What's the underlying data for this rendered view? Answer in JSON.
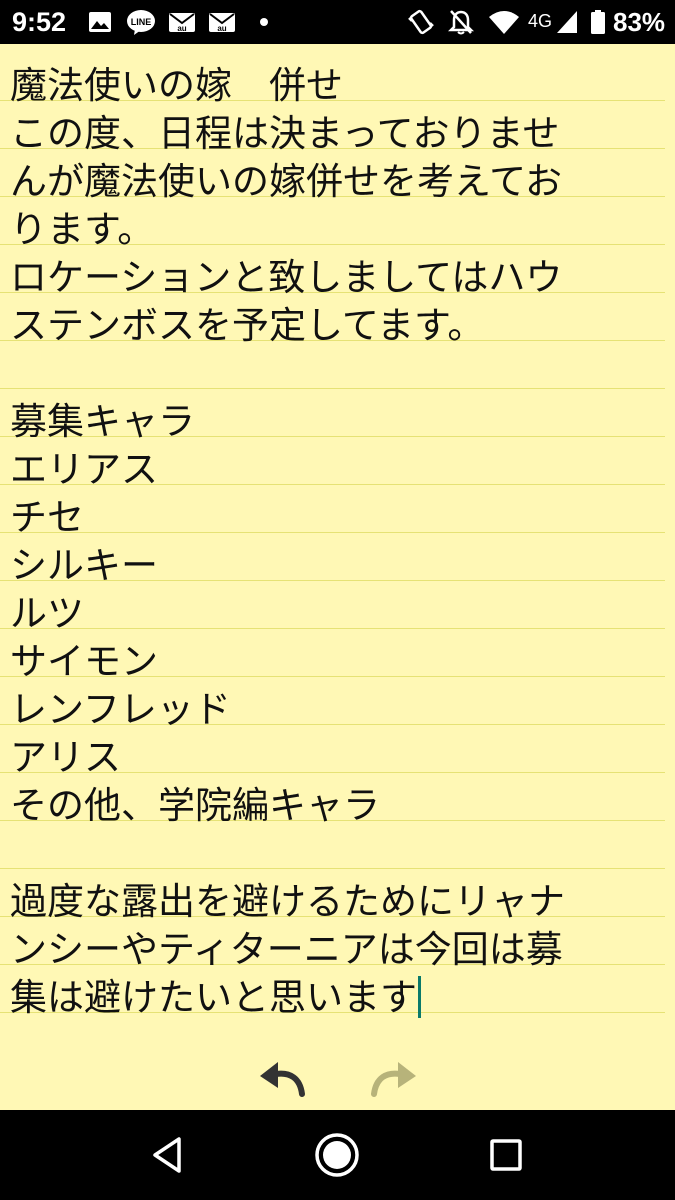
{
  "status_bar": {
    "time": "9:52",
    "network": "4G",
    "battery": "83%",
    "icons": [
      "gallery-icon",
      "line-app-icon",
      "au-mail-icon",
      "au-mail-icon",
      "notification-dot-icon",
      "vibrate-icon",
      "notifications-off-icon",
      "wifi-icon",
      "cellular-signal-icon",
      "battery-icon"
    ],
    "line_badge": "LINE",
    "au_badge": "au"
  },
  "note": {
    "lines": [
      "魔法使いの嫁　併せ",
      "この度、日程は決まっておりませ",
      "んが魔法使いの嫁併せを考えてお",
      "ります。",
      "ロケーションと致しましてはハウ",
      "ステンボスを予定してます。",
      "",
      "募集キャラ",
      "エリアス",
      "チセ",
      "シルキー",
      "ルツ",
      "サイモン",
      "レンフレッド",
      "アリス",
      "その他、学院編キャラ",
      "",
      "過度な露出を避けるためにリャナ",
      "ンシーやティターニアは今回は募",
      "集は避けたいと思います"
    ],
    "cursor_after_line": 19
  },
  "toolbar": {
    "undo": "undo-icon",
    "redo": "redo-icon"
  },
  "nav_bar": {
    "back": "back-icon",
    "home": "home-icon",
    "recents": "recents-icon"
  },
  "colors": {
    "note_background": "#fff8b5",
    "ruled_line": "#e6e275",
    "text": "#111111",
    "cursor": "#0a7a6a",
    "bars": "#000000"
  }
}
